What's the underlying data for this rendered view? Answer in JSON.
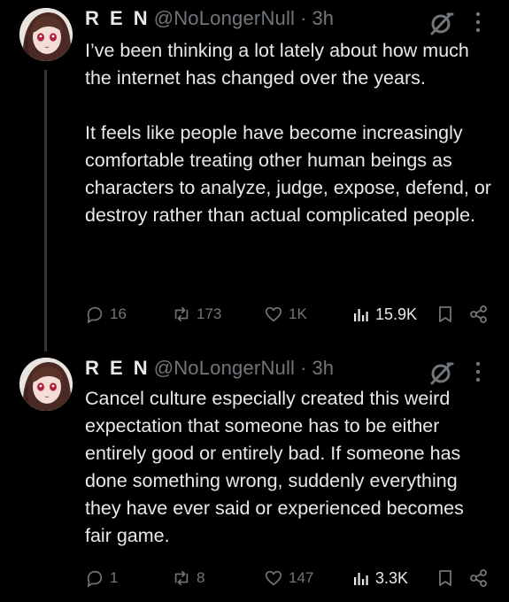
{
  "tweets": [
    {
      "author_name": "R E N",
      "handle": "@NoLongerNull",
      "separator": "·",
      "time": "3h",
      "text": "I’ve been thinking a lot lately about how much the internet has changed over the years.\n\nIt feels like people have become increasingly comfortable treating other human beings as characters to analyze, judge, expose, defend, or destroy rather than actual complicated people.",
      "replies": "16",
      "reposts": "173",
      "likes": "1K",
      "views": "15.9K",
      "icons": [
        "avatar",
        "null-badge-icon",
        "more-icon",
        "reply-icon",
        "repost-icon",
        "like-icon",
        "views-icon",
        "bookmark-icon",
        "share-icon"
      ]
    },
    {
      "author_name": "R E N",
      "handle": "@NoLongerNull",
      "separator": "·",
      "time": "3h",
      "text": "Cancel culture especially created this weird expectation that someone has to be either entirely good or entirely bad. If someone has done something wrong, suddenly everything they have ever said or experienced becomes fair game.",
      "replies": "1",
      "reposts": "8",
      "likes": "147",
      "views": "3.3K",
      "icons": [
        "avatar",
        "null-badge-icon",
        "more-icon",
        "reply-icon",
        "repost-icon",
        "like-icon",
        "views-icon",
        "bookmark-icon",
        "share-icon"
      ]
    }
  ],
  "colors": {
    "background": "#000000",
    "text": "#e7e9ea",
    "muted": "#71767b",
    "thread_line": "#333639"
  }
}
